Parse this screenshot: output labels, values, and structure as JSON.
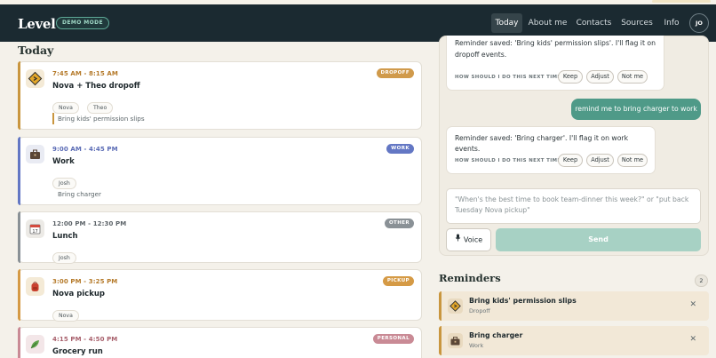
{
  "app": {
    "brand": "Level",
    "demo_badge": "DEMO MODE",
    "user_initials": "JO"
  },
  "nav": [
    {
      "label": "Today",
      "active": true
    },
    {
      "label": "About me",
      "active": false
    },
    {
      "label": "Contacts",
      "active": false
    },
    {
      "label": "Sources",
      "active": false
    },
    {
      "label": "Info",
      "active": false
    }
  ],
  "today": {
    "title": "Today",
    "events": [
      {
        "time": "7:45 AM - 8:15 AM",
        "title": "Nova + Theo dropoff",
        "badge": "DROPOFF",
        "color": "#c9963f",
        "icon": "road-sign-icon",
        "chips": [
          "Nova",
          "Theo"
        ],
        "note": "Bring kids' permission slips"
      },
      {
        "time": "9:00 AM - 4:45 PM",
        "title": "Work",
        "badge": "WORK",
        "color": "#6377c4",
        "icon": "briefcase-icon",
        "chips": [
          "Josh"
        ],
        "note": "Bring charger"
      },
      {
        "time": "12:00 PM - 12:30 PM",
        "title": "Lunch",
        "badge": "OTHER",
        "color": "#8a9196",
        "icon": "calendar-icon",
        "chips": [
          "Josh"
        ],
        "note": ""
      },
      {
        "time": "3:00 PM - 3:25 PM",
        "title": "Nova pickup",
        "badge": "PICKUP",
        "color": "#d59a45",
        "icon": "backpack-icon",
        "chips": [
          "Nova"
        ],
        "note": ""
      },
      {
        "time": "4:15 PM - 4:50 PM",
        "title": "Grocery run",
        "badge": "PERSONAL",
        "color": "#c98a95",
        "icon": "leaf-icon",
        "chips": [],
        "note": ""
      }
    ]
  },
  "chat": {
    "messages": [
      {
        "role": "assistant",
        "text_line1": "Reminder saved: 'Bring kids' permission slips'. I'll flag it on",
        "text_line2": "dropoff events.",
        "ask": "HOW SHOULD I DO THIS NEXT TIME?",
        "options": [
          "Keep",
          "Adjust",
          "Not me"
        ]
      },
      {
        "role": "user",
        "text": "remind me to bring charger to work"
      },
      {
        "role": "assistant",
        "text_line1": "Reminder saved: 'Bring charger'. I'll flag it on work events.",
        "ask": "HOW SHOULD I DO THIS NEXT TIME?",
        "options": [
          "Keep",
          "Adjust",
          "Not me"
        ]
      }
    ],
    "input_placeholder_line1": "\"When's the best time to book team-dinner this week?\" or \"put back",
    "input_placeholder_line2": "Tuesday Nova pickup\"",
    "voice_label": "Voice",
    "send_label": "Send"
  },
  "reminders": {
    "title": "Reminders",
    "count": "2",
    "items": [
      {
        "title": "Bring kids' permission slips",
        "context": "Dropoff",
        "icon": "road-sign-icon"
      },
      {
        "title": "Bring charger",
        "context": "Work",
        "icon": "briefcase-icon"
      }
    ]
  },
  "colors": {
    "topbar": "#1b2a31",
    "accent": "#4f9a88",
    "send_disabled": "#a7d1c4",
    "reminder_bg": "#f2e8d7"
  }
}
